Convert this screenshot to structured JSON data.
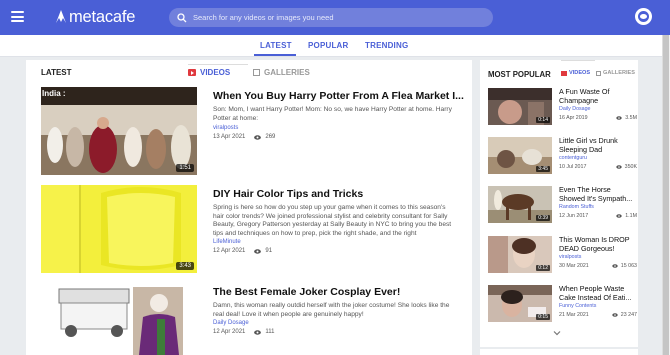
{
  "header": {
    "logo_text": "metacafe",
    "search_placeholder": "Search for any videos or images you need"
  },
  "nav_tabs": [
    {
      "label": "LATEST",
      "active": true
    },
    {
      "label": "POPULAR",
      "active": false
    },
    {
      "label": "TRENDING",
      "active": false
    }
  ],
  "main": {
    "heading": "LATEST",
    "videos_tab": "VIDEOS",
    "galleries_tab": "GALLERIES",
    "items": [
      {
        "title": "When You Buy Harry Potter From A Flea Market I...",
        "description": "Son: Mom, I want Harry Potter! Mom: No so, we have Harry Potter at home. Harry Potter at home:",
        "source": "viralposts",
        "date": "13 Apr 2021",
        "views": "269",
        "duration": "1:51",
        "overlay_text": "India :"
      },
      {
        "title": "DIY Hair Color Tips and Tricks",
        "description": "Spring is here so how do you step up your game when it comes to this season's hair color trends? We joined professional stylist and celebrity consultant for Sally Beauty, Gregory Patterson yesterday at Sally Beauty in NYC to bring you the best tips and techniques on how to prep, pick the right shade, and the right",
        "source": "LifeMinute",
        "date": "12 Apr 2021",
        "views": "91",
        "duration": "3:43"
      },
      {
        "title": "The Best Female Joker Cosplay Ever!",
        "description": "Damn, this woman really outdid herself with the joker costume! She looks like the real deal! Love it when people are genuinely happy!",
        "source": "Daily Dosage",
        "date": "12 Apr 2021",
        "views": "111",
        "duration": ""
      }
    ]
  },
  "sidebar": {
    "heading": "MOST POPULAR",
    "videos_tab": "VIDEOS",
    "galleries_tab": "GALLERIES",
    "items": [
      {
        "title": "A Fun Waste Of Champagne",
        "source": "Daily Dosage",
        "date": "16 Apr 2019",
        "views": "3.5M",
        "duration": "0:14"
      },
      {
        "title": "Little Girl vs Drunk Sleeping Dad",
        "source": "contentguru",
        "date": "10 Jul 2017",
        "views": "350K",
        "duration": "3:45"
      },
      {
        "title": "Even The Horse Showed It's Sympath...",
        "source": "Random Stuffs",
        "date": "12 Jun 2017",
        "views": "1.1M",
        "duration": "0:39"
      },
      {
        "title": "This Woman Is DROP DEAD Gorgeous!",
        "source": "viralposts",
        "date": "30 Mar 2021",
        "views": "15 063",
        "duration": "0:12"
      },
      {
        "title": "When People Waste Cake Instead Of Eati...",
        "source": "Funny Contents",
        "date": "21 Mar 2021",
        "views": "23 247",
        "duration": "0:15"
      }
    ]
  },
  "colors": {
    "brand": "#4a5fd6",
    "accent_red": "#e0393e"
  }
}
